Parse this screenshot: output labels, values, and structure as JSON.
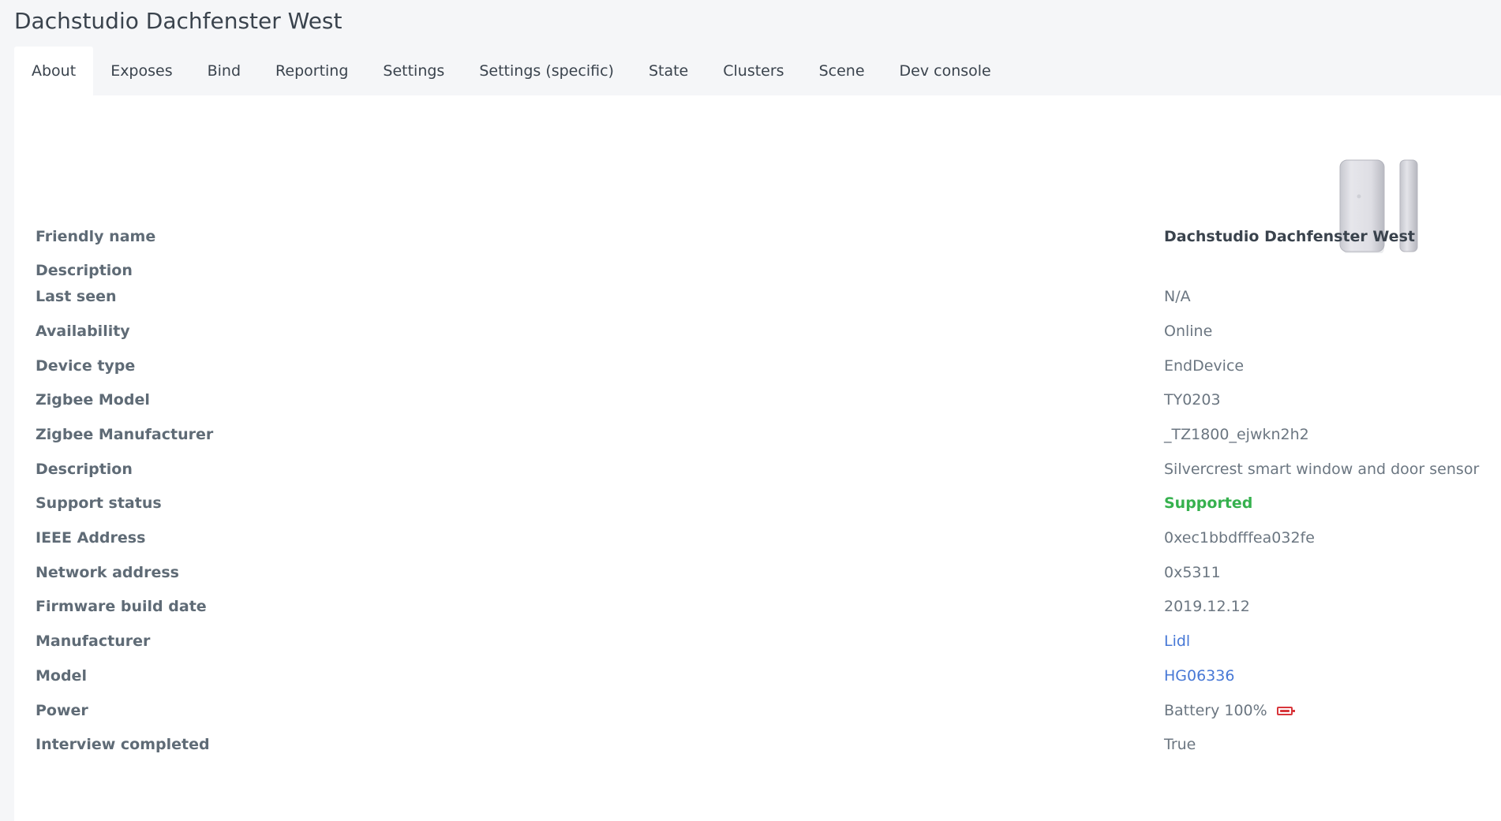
{
  "page": {
    "title": "Dachstudio Dachfenster West"
  },
  "tabs": [
    {
      "label": "About",
      "active": true
    },
    {
      "label": "Exposes"
    },
    {
      "label": "Bind"
    },
    {
      "label": "Reporting"
    },
    {
      "label": "Settings"
    },
    {
      "label": "Settings (specific)"
    },
    {
      "label": "State"
    },
    {
      "label": "Clusters"
    },
    {
      "label": "Scene"
    },
    {
      "label": "Dev console"
    }
  ],
  "device_image": {
    "icon": "door-window-sensor-image"
  },
  "about": {
    "friendly_name": {
      "label": "Friendly name",
      "value": "Dachstudio Dachfenster West"
    },
    "description_custom": {
      "label": "Description",
      "value": ""
    },
    "last_seen": {
      "label": "Last seen",
      "value": "N/A"
    },
    "availability": {
      "label": "Availability",
      "value": "Online"
    },
    "device_type": {
      "label": "Device type",
      "value": "EndDevice"
    },
    "zigbee_model": {
      "label": "Zigbee Model",
      "value": "TY0203"
    },
    "zigbee_manufacturer": {
      "label": "Zigbee Manufacturer",
      "value": "_TZ1800_ejwkn2h2"
    },
    "description": {
      "label": "Description",
      "value": "Silvercrest smart window and door sensor"
    },
    "support_status": {
      "label": "Support status",
      "value": "Supported",
      "color": "#36b14e"
    },
    "ieee_address": {
      "label": "IEEE Address",
      "value": "0xec1bbdfffea032fe"
    },
    "network_address": {
      "label": "Network address",
      "value": "0x5311"
    },
    "firmware_build_date": {
      "label": "Firmware build date",
      "value": "2019.12.12"
    },
    "manufacturer": {
      "label": "Manufacturer",
      "value": "Lidl",
      "link_color": "#4778d6"
    },
    "model": {
      "label": "Model",
      "value": "HG06336",
      "link_color": "#4778d6"
    },
    "power": {
      "label": "Power",
      "value": "Battery 100%",
      "icon": "battery-icon",
      "icon_color": "#d8363b",
      "level": 1.0
    },
    "interview_completed": {
      "label": "Interview completed",
      "value": "True"
    }
  }
}
